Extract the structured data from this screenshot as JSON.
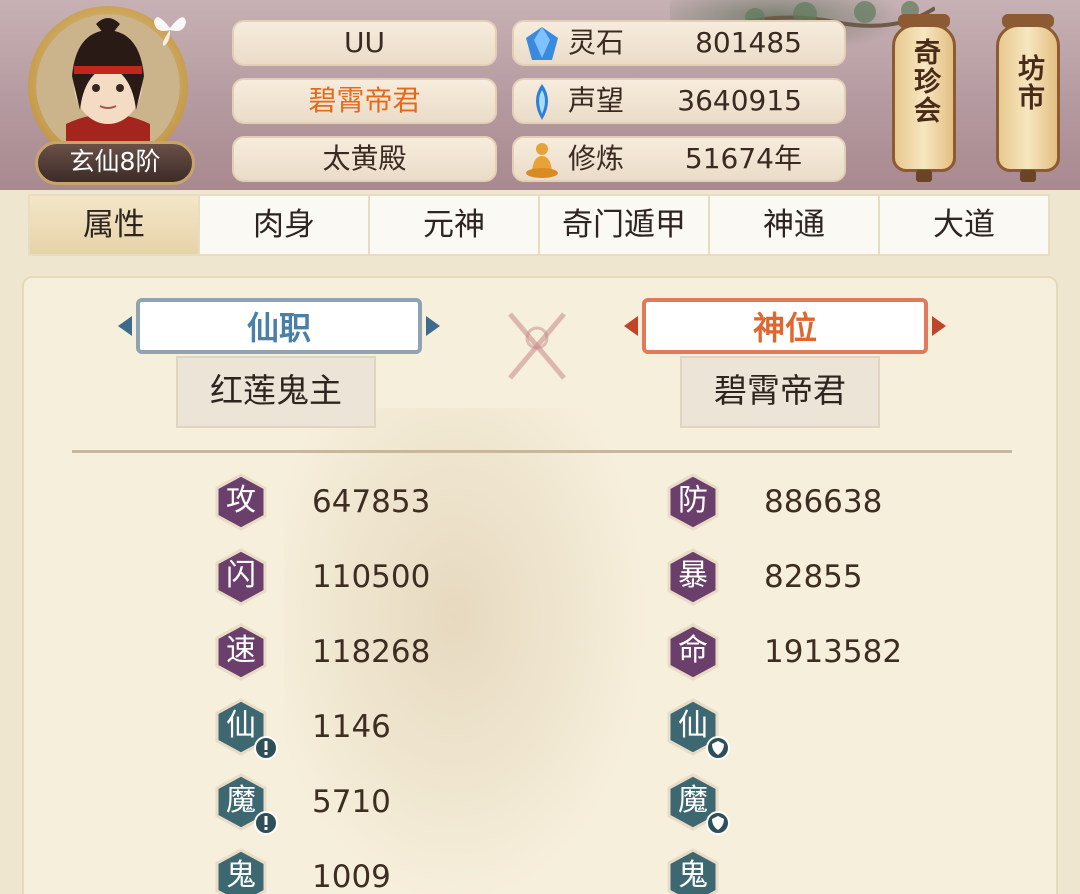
{
  "player": {
    "rank": "玄仙8阶",
    "name": "UU",
    "title": "碧霄帝君",
    "sect": "太黄殿"
  },
  "resources": [
    {
      "icon": "spirit-stone-icon",
      "label": "灵石",
      "value": "801485"
    },
    {
      "icon": "prestige-icon",
      "label": "声望",
      "value": "3640915"
    },
    {
      "icon": "cultivation-icon",
      "label": "修炼",
      "value": "51674年"
    }
  ],
  "shortcuts": {
    "auction": "奇珍会",
    "market": "坊市"
  },
  "tabs": [
    "属性",
    "肉身",
    "元神",
    "奇门遁甲",
    "神通",
    "大道"
  ],
  "positions": {
    "office_label": "仙职",
    "office_value": "红莲鬼主",
    "divine_label": "神位",
    "divine_value": "碧霄帝君"
  },
  "stats_left": [
    {
      "char": "攻",
      "value": "647853"
    },
    {
      "char": "闪",
      "value": "110500"
    },
    {
      "char": "速",
      "value": "118268"
    },
    {
      "char": "仙",
      "value": "1146"
    },
    {
      "char": "魔",
      "value": "5710"
    },
    {
      "char": "鬼",
      "value": "1009"
    }
  ],
  "stats_right": [
    {
      "char": "防",
      "value": "886638"
    },
    {
      "char": "暴",
      "value": "82855"
    },
    {
      "char": "命",
      "value": "1913582"
    },
    {
      "char": "仙",
      "value": ""
    },
    {
      "char": "魔",
      "value": ""
    },
    {
      "char": "鬼",
      "value": ""
    }
  ],
  "colors": {
    "accent_orange": "#e46a1a",
    "badge_purple": "#6b3f6b",
    "badge_teal": "#3d6771",
    "plate_blue": "#4a7fa8",
    "plate_red": "#e0662f"
  }
}
